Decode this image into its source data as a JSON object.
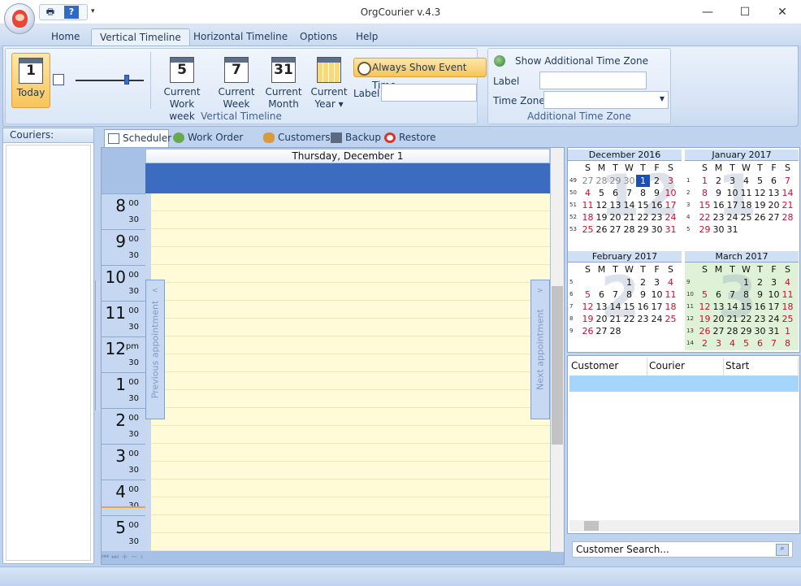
{
  "window": {
    "title": "OrgCourier v.4.3",
    "minimize": "—",
    "maximize": "☐",
    "close": "✕"
  },
  "qat": {
    "print_icon": "printer-icon",
    "help_icon": "help-icon",
    "dropdown": "▾"
  },
  "tabs": [
    "Home",
    "Vertical Timeline",
    "Horizontal Timeline",
    "Options",
    "Help"
  ],
  "ribbon": {
    "today": {
      "num": "1",
      "label": "Today"
    },
    "buttons": [
      {
        "num": "5",
        "label1": "Current",
        "label2": "Work week"
      },
      {
        "num": "7",
        "label1": "Current",
        "label2": "Week"
      },
      {
        "num": "31",
        "label1": "Current",
        "label2": "Month"
      },
      {
        "num": "",
        "label1": "Current",
        "label2": "Year ▾"
      }
    ],
    "always_show": "Always Show Event Time",
    "label_caption": "Label",
    "group_vertical": "Vertical Timeline",
    "show_tz": "Show Additional Time Zone",
    "tz_label": "Label",
    "tz_zone": "Time Zone",
    "group_tz": "Additional Time Zone"
  },
  "couriers": {
    "header": "Couriers:"
  },
  "view_tabs": [
    "Scheduler",
    "Work Order List",
    "Customers",
    "Backup",
    "Restore"
  ],
  "scheduler": {
    "day": "Thursday, December 1",
    "prev": "Previous appointment",
    "next": "Next appointment",
    "hours": [
      {
        "h": "8",
        "m": "00"
      },
      {
        "h": "9",
        "m": "00"
      },
      {
        "h": "10",
        "m": "00"
      },
      {
        "h": "11",
        "m": "00"
      },
      {
        "h": "12",
        "m": "pm"
      },
      {
        "h": "1",
        "m": "00"
      },
      {
        "h": "2",
        "m": "00"
      },
      {
        "h": "3",
        "m": "00"
      },
      {
        "h": "4",
        "m": "00"
      },
      {
        "h": "5",
        "m": "00"
      }
    ],
    "half": "30",
    "nav": "⏮ ⏭ + − ‹"
  },
  "calendars": [
    {
      "title": "December 2016",
      "big": "12",
      "weeks": [
        "49",
        "50",
        "51",
        "52",
        "53"
      ],
      "days": [
        "27",
        "28",
        "29",
        "30",
        "1",
        "2",
        "3",
        "4",
        "5",
        "6",
        "7",
        "8",
        "9",
        "10",
        "11",
        "12",
        "13",
        "14",
        "15",
        "16",
        "17",
        "18",
        "19",
        "20",
        "21",
        "22",
        "23",
        "24",
        "25",
        "26",
        "27",
        "28",
        "29",
        "30",
        "31"
      ]
    },
    {
      "title": "January 2017",
      "big": "1",
      "weeks": [
        "1",
        "2",
        "3",
        "4",
        "5"
      ],
      "days": [
        "1",
        "2",
        "3",
        "4",
        "5",
        "6",
        "7",
        "8",
        "9",
        "10",
        "11",
        "12",
        "13",
        "14",
        "15",
        "16",
        "17",
        "18",
        "19",
        "20",
        "21",
        "22",
        "23",
        "24",
        "25",
        "26",
        "27",
        "28",
        "29",
        "30",
        "31"
      ]
    },
    {
      "title": "February 2017",
      "big": "2",
      "weeks": [
        "5",
        "6",
        "7",
        "8",
        "9"
      ],
      "days": [
        "1",
        "2",
        "3",
        "4",
        "5",
        "6",
        "7",
        "8",
        "9",
        "10",
        "11",
        "12",
        "13",
        "14",
        "15",
        "16",
        "17",
        "18",
        "19",
        "20",
        "21",
        "22",
        "23",
        "24",
        "25",
        "26",
        "27",
        "28"
      ]
    },
    {
      "title": "March 2017",
      "big": "3",
      "weeks": [
        "9",
        "10",
        "11",
        "12",
        "13",
        "14"
      ],
      "days": [
        "1",
        "2",
        "3",
        "4",
        "5",
        "6",
        "7",
        "8",
        "9",
        "10",
        "11",
        "12",
        "13",
        "14",
        "15",
        "16",
        "17",
        "18",
        "19",
        "20",
        "21",
        "22",
        "23",
        "24",
        "25",
        "26",
        "27",
        "28",
        "29",
        "30",
        "31",
        "1",
        "2",
        "3",
        "4",
        "5",
        "6",
        "7",
        "8"
      ]
    }
  ],
  "weekdays": [
    "S",
    "M",
    "T",
    "W",
    "T",
    "F",
    "S"
  ],
  "grid": {
    "columns": [
      "Customer",
      "Courier",
      "Start"
    ]
  },
  "search": {
    "placeholder": "Customer Search..."
  }
}
